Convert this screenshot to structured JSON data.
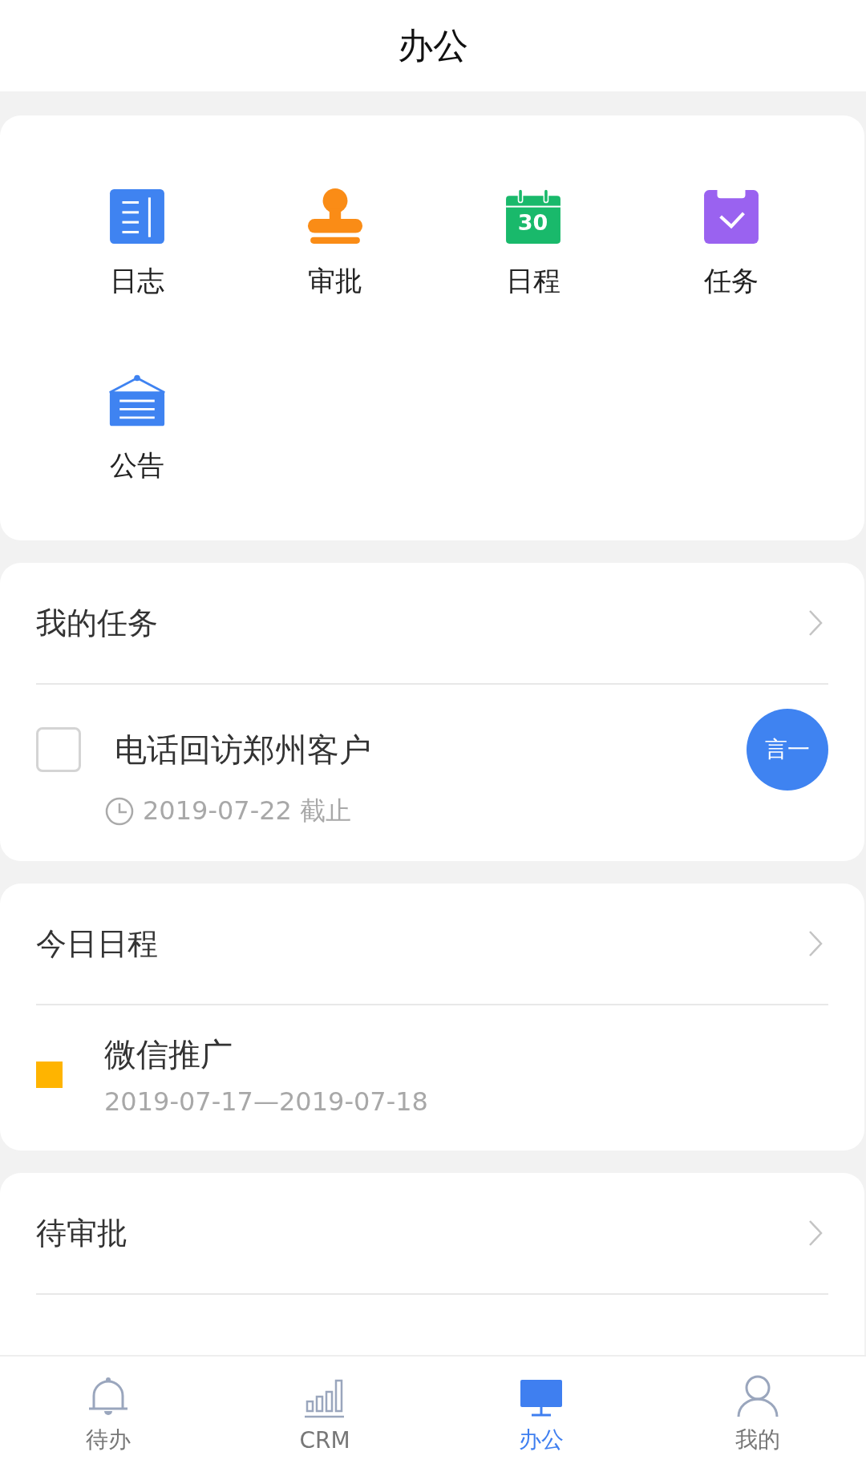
{
  "header": {
    "title": "办公"
  },
  "apps": [
    {
      "label": "日志",
      "kind": "log"
    },
    {
      "label": "审批",
      "kind": "stamp"
    },
    {
      "label": "日程",
      "kind": "calendar",
      "icon_text": "30"
    },
    {
      "label": "任务",
      "kind": "task"
    },
    {
      "label": "公告",
      "kind": "notice"
    }
  ],
  "my_tasks": {
    "title": "我的任务",
    "items": [
      {
        "title": "电话回访郑州客户",
        "checked": false,
        "due": "2019-07-22 截止",
        "assignee": "言一"
      }
    ]
  },
  "today_schedule": {
    "title": "今日日程",
    "items": [
      {
        "title": "微信推广",
        "time": "2019-07-17—2019-07-18",
        "color": "#ffb400"
      }
    ]
  },
  "pending_approval": {
    "title": "待审批"
  },
  "tab_bar": [
    {
      "label": "待办",
      "kind": "bell",
      "selected": false
    },
    {
      "label": "CRM",
      "kind": "chart",
      "selected": false
    },
    {
      "label": "办公",
      "kind": "monitor",
      "selected": true
    },
    {
      "label": "我的",
      "kind": "person",
      "selected": false
    }
  ]
}
